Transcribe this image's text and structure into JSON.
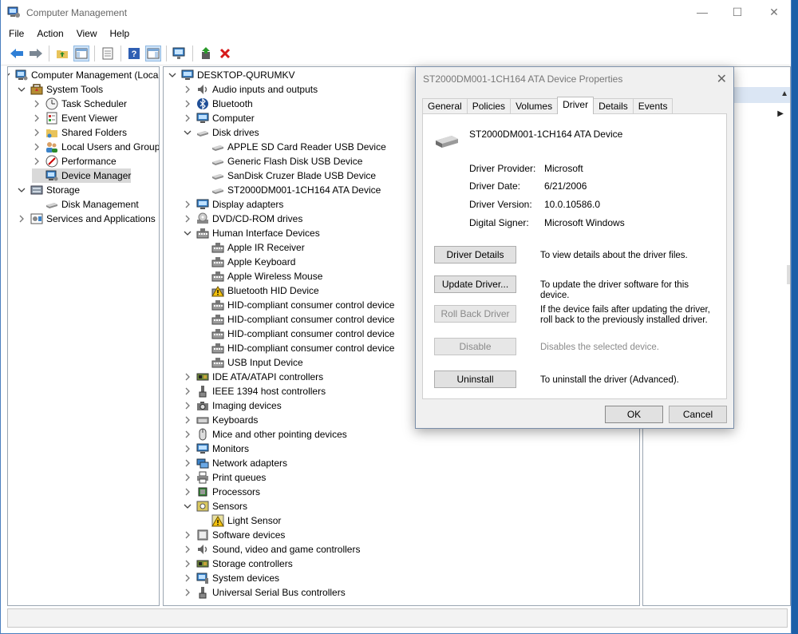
{
  "window": {
    "title": "Computer Management"
  },
  "menu": [
    "File",
    "Action",
    "View",
    "Help"
  ],
  "left_tree": {
    "root": "Computer Management (Local",
    "items": [
      {
        "label": "System Tools",
        "level": 1,
        "state": "expanded",
        "icon": "toolbox-icon"
      },
      {
        "label": "Task Scheduler",
        "level": 2,
        "state": "collapsed",
        "icon": "clock-icon"
      },
      {
        "label": "Event Viewer",
        "level": 2,
        "state": "collapsed",
        "icon": "event-viewer-icon"
      },
      {
        "label": "Shared Folders",
        "level": 2,
        "state": "collapsed",
        "icon": "shared-folder-icon"
      },
      {
        "label": "Local Users and Groups",
        "level": 2,
        "state": "collapsed",
        "icon": "users-icon"
      },
      {
        "label": "Performance",
        "level": 2,
        "state": "collapsed",
        "icon": "performance-icon"
      },
      {
        "label": "Device Manager",
        "level": 2,
        "state": "none",
        "icon": "device-manager-icon",
        "selected": true
      },
      {
        "label": "Storage",
        "level": 1,
        "state": "expanded",
        "icon": "storage-icon"
      },
      {
        "label": "Disk Management",
        "level": 2,
        "state": "none",
        "icon": "disk-management-icon"
      },
      {
        "label": "Services and Applications",
        "level": 1,
        "state": "collapsed",
        "icon": "services-icon"
      }
    ]
  },
  "device_tree": {
    "root": "DESKTOP-QURUMKV",
    "items": [
      {
        "label": "Audio inputs and outputs",
        "level": 1,
        "state": "collapsed",
        "icon": "speaker-icon"
      },
      {
        "label": "Bluetooth",
        "level": 1,
        "state": "collapsed",
        "icon": "bluetooth-icon"
      },
      {
        "label": "Computer",
        "level": 1,
        "state": "collapsed",
        "icon": "computer-icon"
      },
      {
        "label": "Disk drives",
        "level": 1,
        "state": "expanded",
        "icon": "disk-drive-icon"
      },
      {
        "label": "APPLE SD Card Reader USB Device",
        "level": 2,
        "state": "none",
        "icon": "disk-drive-icon"
      },
      {
        "label": "Generic Flash Disk USB Device",
        "level": 2,
        "state": "none",
        "icon": "disk-drive-icon"
      },
      {
        "label": "SanDisk Cruzer Blade USB Device",
        "level": 2,
        "state": "none",
        "icon": "disk-drive-icon"
      },
      {
        "label": "ST2000DM001-1CH164 ATA Device",
        "level": 2,
        "state": "none",
        "icon": "disk-drive-icon"
      },
      {
        "label": "Display adapters",
        "level": 1,
        "state": "collapsed",
        "icon": "monitor-icon"
      },
      {
        "label": "DVD/CD-ROM drives",
        "level": 1,
        "state": "collapsed",
        "icon": "dvd-icon"
      },
      {
        "label": "Human Interface Devices",
        "level": 1,
        "state": "expanded",
        "icon": "hid-icon"
      },
      {
        "label": "Apple IR Receiver",
        "level": 2,
        "state": "none",
        "icon": "hid-icon"
      },
      {
        "label": "Apple Keyboard",
        "level": 2,
        "state": "none",
        "icon": "hid-icon"
      },
      {
        "label": "Apple Wireless Mouse",
        "level": 2,
        "state": "none",
        "icon": "hid-icon"
      },
      {
        "label": "Bluetooth HID Device",
        "level": 2,
        "state": "none",
        "icon": "warning-hid-icon"
      },
      {
        "label": "HID-compliant consumer control device",
        "level": 2,
        "state": "none",
        "icon": "hid-icon"
      },
      {
        "label": "HID-compliant consumer control device",
        "level": 2,
        "state": "none",
        "icon": "hid-icon"
      },
      {
        "label": "HID-compliant consumer control device",
        "level": 2,
        "state": "none",
        "icon": "hid-icon"
      },
      {
        "label": "HID-compliant consumer control device",
        "level": 2,
        "state": "none",
        "icon": "hid-icon"
      },
      {
        "label": "USB Input Device",
        "level": 2,
        "state": "none",
        "icon": "hid-icon"
      },
      {
        "label": "IDE ATA/ATAPI controllers",
        "level": 1,
        "state": "collapsed",
        "icon": "ide-controller-icon"
      },
      {
        "label": "IEEE 1394 host controllers",
        "level": 1,
        "state": "collapsed",
        "icon": "firewire-icon"
      },
      {
        "label": "Imaging devices",
        "level": 1,
        "state": "collapsed",
        "icon": "camera-icon"
      },
      {
        "label": "Keyboards",
        "level": 1,
        "state": "collapsed",
        "icon": "keyboard-icon"
      },
      {
        "label": "Mice and other pointing devices",
        "level": 1,
        "state": "collapsed",
        "icon": "mouse-icon"
      },
      {
        "label": "Monitors",
        "level": 1,
        "state": "collapsed",
        "icon": "monitor-icon"
      },
      {
        "label": "Network adapters",
        "level": 1,
        "state": "collapsed",
        "icon": "network-icon"
      },
      {
        "label": "Print queues",
        "level": 1,
        "state": "collapsed",
        "icon": "printer-icon"
      },
      {
        "label": "Processors",
        "level": 1,
        "state": "collapsed",
        "icon": "processor-icon"
      },
      {
        "label": "Sensors",
        "level": 1,
        "state": "expanded",
        "icon": "sensor-icon"
      },
      {
        "label": "Light Sensor",
        "level": 2,
        "state": "none",
        "icon": "warning-sensor-icon"
      },
      {
        "label": "Software devices",
        "level": 1,
        "state": "collapsed",
        "icon": "software-device-icon"
      },
      {
        "label": "Sound, video and game controllers",
        "level": 1,
        "state": "collapsed",
        "icon": "speaker-icon"
      },
      {
        "label": "Storage controllers",
        "level": 1,
        "state": "collapsed",
        "icon": "storage-controller-icon"
      },
      {
        "label": "System devices",
        "level": 1,
        "state": "collapsed",
        "icon": "system-device-icon"
      },
      {
        "label": "Universal Serial Bus controllers",
        "level": 1,
        "state": "collapsed",
        "icon": "usb-icon"
      }
    ]
  },
  "dialog": {
    "title": "ST2000DM001-1CH164 ATA Device Properties",
    "tabs": [
      "General",
      "Policies",
      "Volumes",
      "Driver",
      "Details",
      "Events"
    ],
    "active_tab": "Driver",
    "device_name": "ST2000DM001-1CH164 ATA Device",
    "fields": [
      {
        "label": "Driver Provider:",
        "value": "Microsoft"
      },
      {
        "label": "Driver Date:",
        "value": "6/21/2006"
      },
      {
        "label": "Driver Version:",
        "value": "10.0.10586.0"
      },
      {
        "label": "Digital Signer:",
        "value": "Microsoft Windows"
      }
    ],
    "actions": [
      {
        "button": "Driver Details",
        "desc": "To view details about the driver files.",
        "enabled": true
      },
      {
        "button": "Update Driver...",
        "desc": "To update the driver software for this device.",
        "enabled": true
      },
      {
        "button": "Roll Back Driver",
        "desc": "If the device fails after updating the driver, roll back to the previously installed driver.",
        "enabled": false
      },
      {
        "button": "Disable",
        "desc": "Disables the selected device.",
        "enabled": false
      },
      {
        "button": "Uninstall",
        "desc": "To uninstall the driver (Advanced).",
        "enabled": true
      }
    ],
    "ok_label": "OK",
    "cancel_label": "Cancel"
  }
}
